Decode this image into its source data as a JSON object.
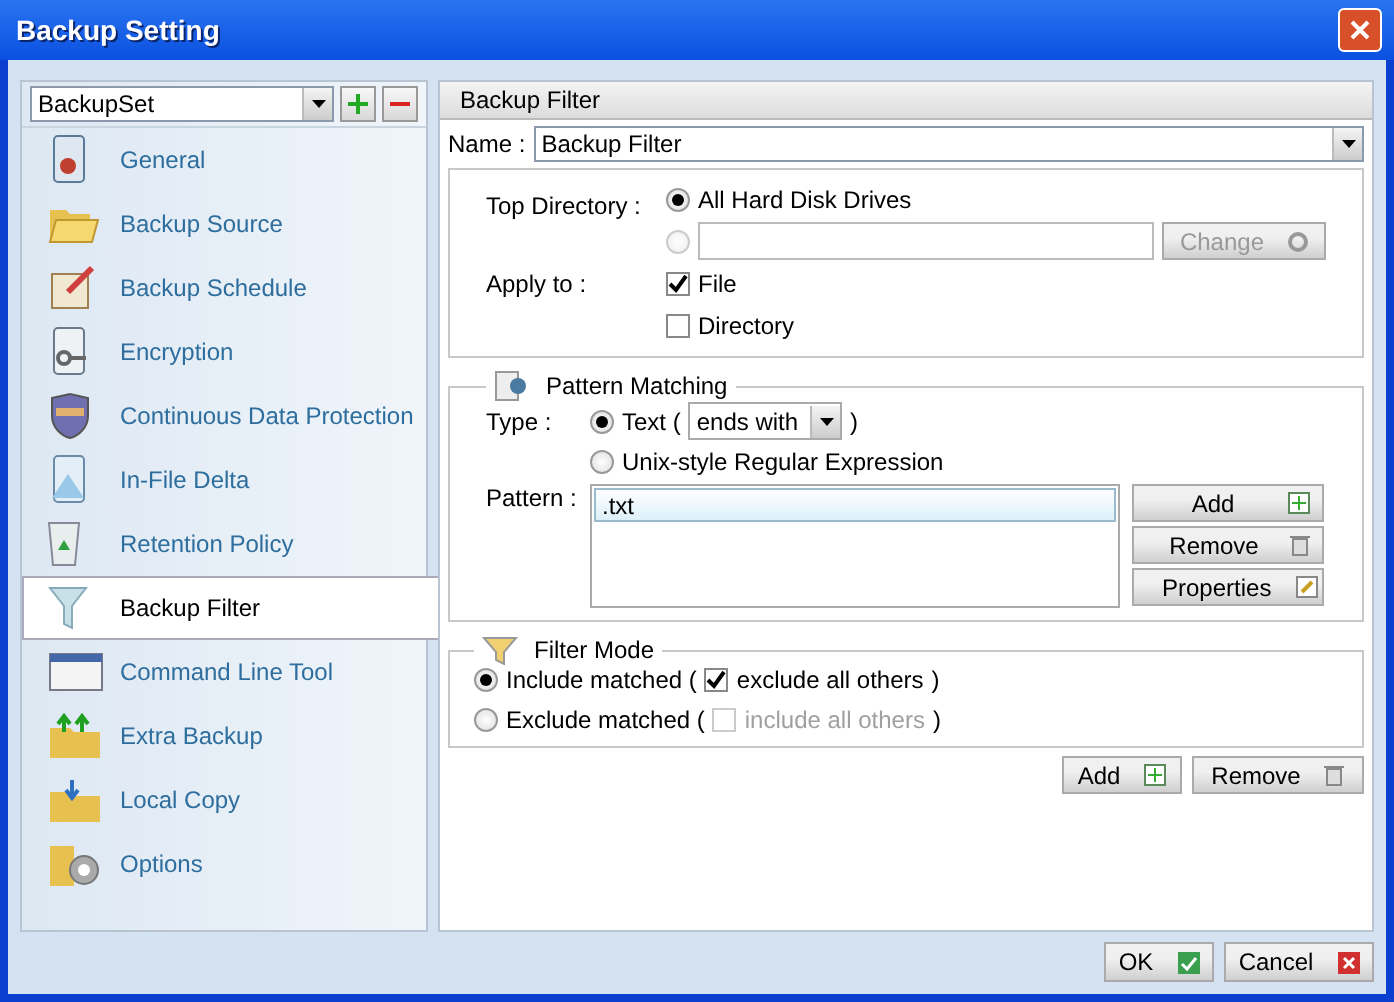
{
  "window": {
    "title": "Backup Setting"
  },
  "backup_set": {
    "value": "BackupSet"
  },
  "sidebar": {
    "items": [
      {
        "label": "General",
        "selected": false
      },
      {
        "label": "Backup Source",
        "selected": false
      },
      {
        "label": "Backup Schedule",
        "selected": false
      },
      {
        "label": "Encryption",
        "selected": false
      },
      {
        "label": "Continuous Data Protection",
        "selected": false
      },
      {
        "label": "In-File Delta",
        "selected": false
      },
      {
        "label": "Retention Policy",
        "selected": false
      },
      {
        "label": "Backup Filter",
        "selected": true
      },
      {
        "label": "Command Line Tool",
        "selected": false
      },
      {
        "label": "Extra Backup",
        "selected": false
      },
      {
        "label": "Local Copy",
        "selected": false
      },
      {
        "label": "Options",
        "selected": false
      }
    ]
  },
  "panel": {
    "title": "Backup Filter"
  },
  "name": {
    "label": "Name :",
    "value": "Backup Filter"
  },
  "top_directory": {
    "label": "Top Directory :",
    "options": [
      {
        "kind": "label",
        "label": "All Hard Disk Drives",
        "selected": true,
        "disabled": false
      },
      {
        "kind": "path",
        "selected": false,
        "disabled": true
      }
    ],
    "change_button": {
      "label": "Change",
      "disabled": true
    }
  },
  "apply_to": {
    "label": "Apply to :",
    "options": [
      {
        "label": "File",
        "checked": true
      },
      {
        "label": "Directory",
        "checked": false
      }
    ]
  },
  "pattern_matching": {
    "title": "Pattern Matching",
    "type_label": "Type :",
    "types": [
      {
        "label": "Text (",
        "match": "ends with",
        "close": ")",
        "selected": true
      },
      {
        "label": "Unix-style Regular Expression",
        "selected": false
      }
    ],
    "pattern_label": "Pattern :",
    "patterns": [
      {
        "text": ".txt",
        "selected": true
      }
    ],
    "buttons": [
      "Add",
      "Remove",
      "Properties"
    ]
  },
  "filter_mode": {
    "title": "Filter Mode",
    "options": [
      {
        "label": "Include matched (",
        "selected": true,
        "sub": {
          "label": "exclude all others",
          "checked": true,
          "disabled": false
        },
        "close": ")"
      },
      {
        "label": "Exclude matched (",
        "selected": false,
        "sub": {
          "label": "include all others",
          "checked": false,
          "disabled": true
        },
        "close": ")"
      }
    ]
  },
  "filter_buttons": [
    "Add",
    "Remove"
  ],
  "dialog_buttons": [
    "OK",
    "Cancel"
  ]
}
